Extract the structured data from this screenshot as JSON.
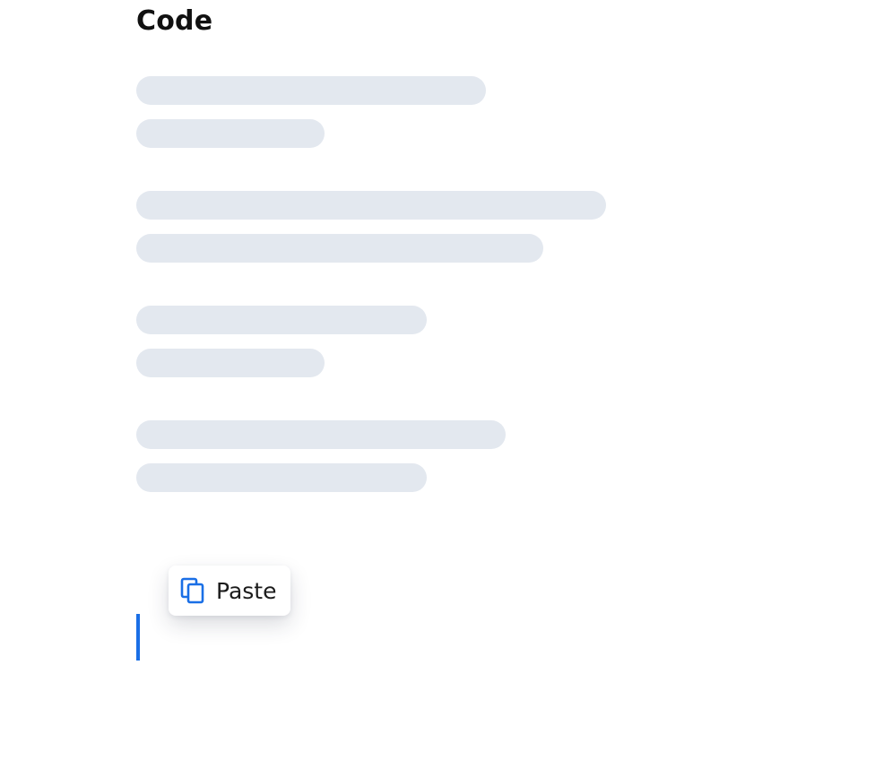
{
  "page": {
    "title": "Code"
  },
  "skeleton_lines": [
    {
      "name": "skeleton-line-1"
    },
    {
      "name": "skeleton-line-2"
    },
    {
      "name": "skeleton-line-3"
    },
    {
      "name": "skeleton-line-4"
    },
    {
      "name": "skeleton-line-5"
    },
    {
      "name": "skeleton-line-6"
    },
    {
      "name": "skeleton-line-7"
    },
    {
      "name": "skeleton-line-8"
    }
  ],
  "context_menu": {
    "paste_label": "Paste",
    "paste_icon": "copy-icon"
  },
  "colors": {
    "accent": "#1a6fe6",
    "skeleton": "#e3e8ef",
    "text": "#111111"
  }
}
